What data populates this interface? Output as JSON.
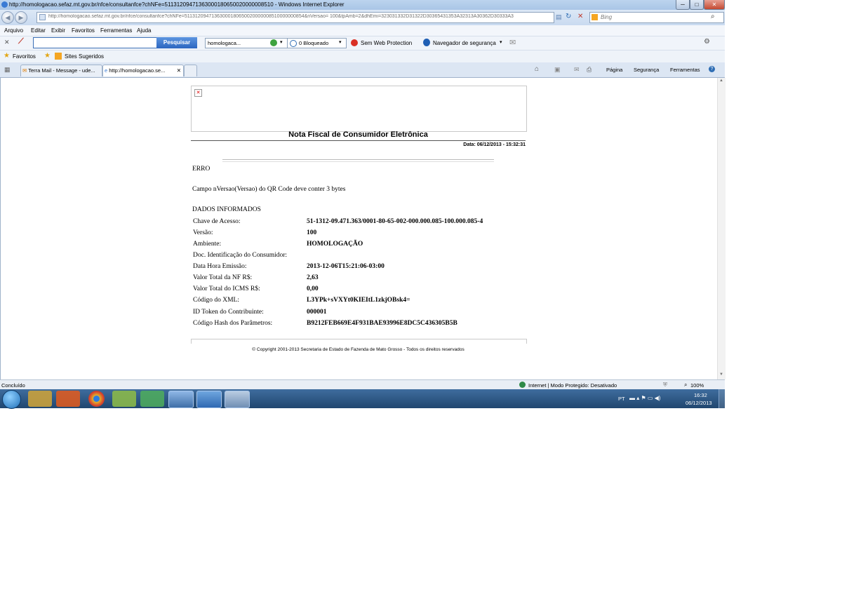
{
  "window": {
    "title": "http://homologacao.sefaz.mt.gov.br/nfce/consultanfce?chNFe=51131209471363000180650020000008510 - Windows Internet Explorer",
    "min": "─",
    "max": "□",
    "close": "✕"
  },
  "address": {
    "url": "http://homologacao.sefaz.mt.gov.br/nfce/consultanfce?chNFe=51131209471363000180650020000008510000000854&nVersao= 100&tpAmb=2&dhEmi=323031332D31322D30365431353A32313A30362D30333A3",
    "search_placeholder": "Bing"
  },
  "menu": [
    "Arquivo",
    "Editar",
    "Exibir",
    "Favoritos",
    "Ferramentas",
    "Ajuda"
  ],
  "toolbar": {
    "search_button": "Pesquisar",
    "dropdown_value": "homologaca...",
    "blocked": "0 Bloqueado",
    "web_protection": "Sem Web Protection",
    "safe_nav": "Navegador de segurança"
  },
  "favorites": {
    "favorites_label": "Favoritos",
    "suggested": "Sites Sugeridos"
  },
  "tabs": [
    {
      "label": "Terra Mail - Message - ude..."
    },
    {
      "label": "http://homologacao.se..."
    }
  ],
  "command_bar": [
    "Página",
    "Segurança",
    "Ferramentas"
  ],
  "page": {
    "header_title": "Nota Fiscal de Consumidor Eletrônica",
    "date": "Data: 06/12/2013 - 15:32:31",
    "error_title": "ERRO",
    "error_message": "Campo nVersao(Versao) do QR Code deve conter 3 bytes",
    "section_title": "DADOS INFORMADOS",
    "fields": [
      {
        "label": "Chave de Acesso:",
        "value": "51-1312-09.471.363/0001-80-65-002-000.000.085-100.000.085-4"
      },
      {
        "label": "Versão:",
        "value": "100"
      },
      {
        "label": "Ambiente:",
        "value": "HOMOLOGAÇÃO"
      },
      {
        "label": "Doc. Identificação do Consumidor:",
        "value": ""
      },
      {
        "label": "Data Hora Emissão:",
        "value": "2013-12-06T15:21:06-03:00"
      },
      {
        "label": "Valor Total da NF R$:",
        "value": "2,63"
      },
      {
        "label": "Valor Total do ICMS R$:",
        "value": "0,00"
      },
      {
        "label": "Código do XML:",
        "value": "L3YPk+sVXYt0KIEItL1zkjOBsk4="
      },
      {
        "label": "ID Token do Contribuinte:",
        "value": "000001"
      },
      {
        "label": "Código Hash dos Parâmetros:",
        "value": "B9212FEB669E4F931BAE93996E8DC5C436305B5B"
      }
    ],
    "copyright": "© Copyright 2001-2013 Secretaria de Estado de Fazenda de Mato Grosso - Todos os direitos reservados"
  },
  "status": {
    "left": "Concluído",
    "zone": "Internet | Modo Protegido: Desativado",
    "zoom": "100%"
  },
  "taskbar": {
    "lang": "PT",
    "time": "16:32",
    "date": "06/12/2013"
  }
}
